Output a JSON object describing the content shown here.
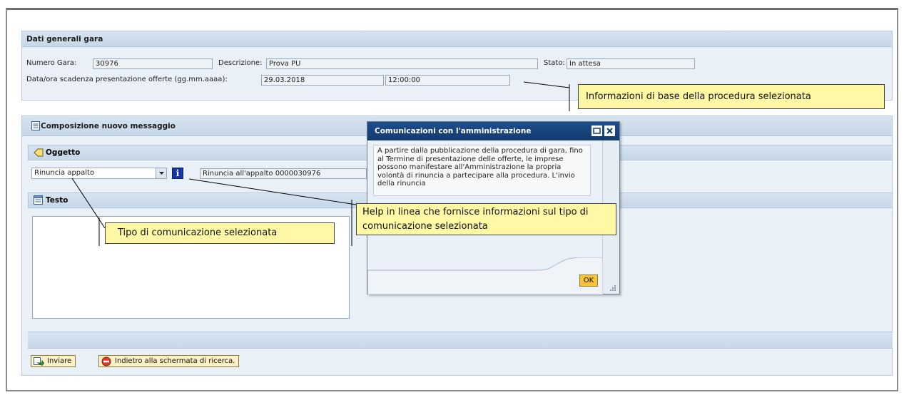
{
  "general": {
    "title": "Dati generali gara",
    "numero_label": "Numero Gara:",
    "numero_value": "30976",
    "descrizione_label": "Descrizione:",
    "descrizione_value": "Prova PU",
    "stato_label": "Stato:",
    "stato_value": "In attesa",
    "scadenza_label": "Data/ora scadenza presentazione offerte (gg.mm.aaaa):",
    "scadenza_date": "29.03.2018",
    "scadenza_time": "12:00:00"
  },
  "compose": {
    "title": "Composizione nuovo messaggio",
    "oggetto_title": "Oggetto",
    "oggetto_select": "Rinuncia appalto",
    "oggetto_value": "Rinuncia all'appalto 0000030976",
    "testo_title": "Testo"
  },
  "buttons": {
    "send": "Inviare",
    "back": "Indietro alla schermata di ricerca."
  },
  "dialog": {
    "title": "Comunicazioni con l'amministrazione",
    "text": "A partire dalla pubblicazione della procedura di gara, fino al Termine di presentazione delle offerte, le imprese possono manifestare all'Amministrazione la propria volontà di rinuncia a partecipare alla procedura. L'invio della rinuncia",
    "ok": "OK"
  },
  "callouts": {
    "base_info": "Informazioni di base della procedura selezionata",
    "help": "Help in linea che fornisce informazioni sul tipo di comunicazione selezionata",
    "tipo": "Tipo di comunicazione selezionata"
  },
  "colors": {
    "panel_bg": "#e9f0f7",
    "header_bg": "#c6d7e8",
    "dialog_title": "#143a6e",
    "callout_bg": "#fff9a6",
    "button_bg": "#fbf1c4"
  }
}
